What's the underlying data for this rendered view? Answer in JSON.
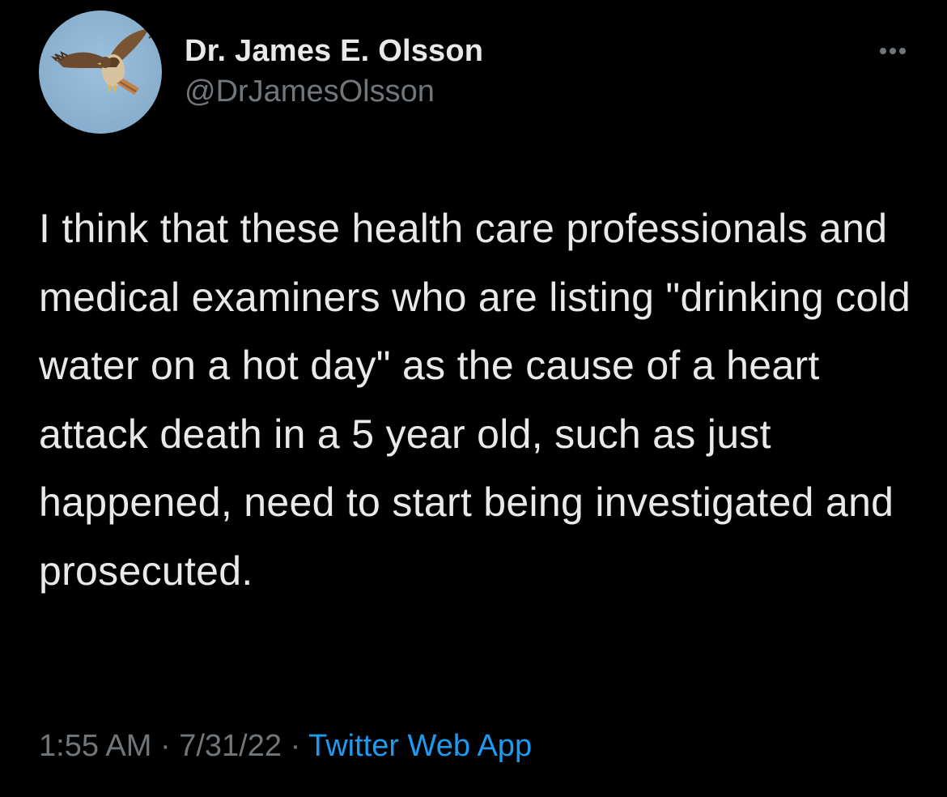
{
  "author": {
    "display_name": "Dr. James E. Olsson",
    "handle": "@DrJamesOlsson",
    "avatar_icon": "hawk-avatar-icon"
  },
  "more_icon": "more-options-icon",
  "tweet": {
    "text": "I think that these health care professionals and medical examiners who are listing \"drinking cold water on a hot day\" as the cause of a heart attack death in a 5 year old, such as just happened, need to start being investigated and prosecuted."
  },
  "meta": {
    "time": "1:55 AM",
    "separator": "·",
    "date": "7/31/22",
    "source": "Twitter Web App"
  },
  "colors": {
    "background": "#000000",
    "text": "#e7e9ea",
    "secondary": "#71767b",
    "link": "#1d9bf0"
  }
}
